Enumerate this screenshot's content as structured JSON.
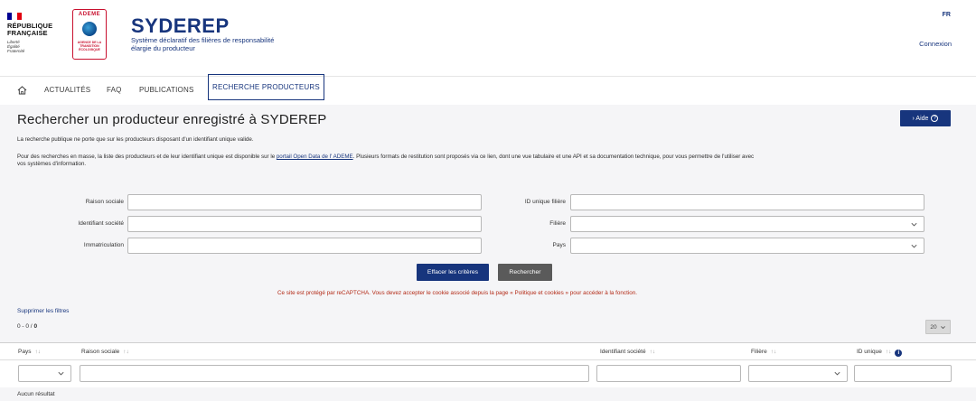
{
  "header": {
    "republic": [
      "RÉPUBLIQUE",
      "FRANÇAISE"
    ],
    "motto": [
      "Liberté",
      "Égalité",
      "Fraternité"
    ],
    "ademe": "ADEME",
    "ademe_sub": [
      "AGENCE DE LA",
      "TRANSITION",
      "ÉCOLOGIQUE"
    ],
    "app_title": "SYDEREP",
    "app_subtitle": "Système déclaratif des filières de responsabilité élargie du producteur",
    "lang": "FR",
    "login": "Connexion",
    "colors": {
      "brand": "#17357d",
      "flag_blue": "#000091",
      "flag_red": "#e1000f"
    }
  },
  "nav": {
    "home_icon": "home-icon",
    "items": [
      "ACTUALITÉS",
      "FAQ",
      "PUBLICATIONS",
      "RECHERCHE PRODUCTEURS"
    ],
    "active": "RECHERCHE PRODUCTEURS"
  },
  "page": {
    "title": "Rechercher un producteur enregistré à SYDEREP",
    "help_button": "› Aide",
    "help_icon": "question-circle-icon",
    "intro": "La recherche publique ne porte que sur les producteurs disposant d'un identifiant unique valide.",
    "bulk_pre": "Pour des recherches en masse, la liste des producteurs et de leur identifiant unique est disponible sur le ",
    "bulk_link": "portail Open Data de l'  ADEME",
    "bulk_post": ". Plusieurs formats de restitution sont proposés via ce lien, dont une vue tabulaire et une API et sa documentation technique, pour vous permettre de l'utiliser avec",
    "bulk_line2": "vos systèmes d'information."
  },
  "form": {
    "raison_sociale": {
      "label": "Raison sociale",
      "value": ""
    },
    "identifiant_societe": {
      "label": "Identifiant société",
      "value": ""
    },
    "immatriculation": {
      "label": "Immatriculation",
      "value": ""
    },
    "id_unique": {
      "label": "ID unique filière",
      "value": ""
    },
    "filiere": {
      "label": "Filière",
      "value": ""
    },
    "pays": {
      "label": "Pays",
      "value": ""
    },
    "clear_button": "Effacer les critères",
    "search_button": "Rechercher",
    "captcha_notice": "Ce site est protégé par reCAPTCHA. Vous devez accepter le cookie associé depuis la page « Politique et cookies » pour accéder à la fonction."
  },
  "results": {
    "clear_filters": "Supprimer les filtres",
    "range": "0 - 0 /",
    "total": "0",
    "page_size": "20",
    "columns": [
      "Pays",
      "Raison sociale",
      "Identifiant société",
      "Filière",
      "ID unique"
    ],
    "sort_glyph": "↑↓",
    "info_glyph": "i",
    "empty": "Aucun résultat"
  }
}
